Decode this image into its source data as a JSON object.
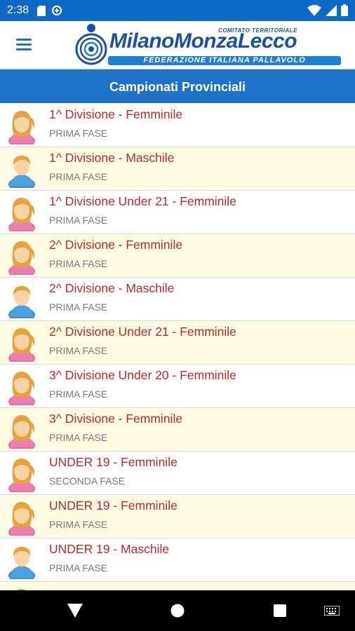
{
  "status_bar": {
    "time": "2:38",
    "icons": [
      "sd-card-icon",
      "data-saver-icon",
      "wifi-icon",
      "signal-icon",
      "battery-icon"
    ]
  },
  "app_bar": {
    "logo": {
      "main_text": "MilanoMonzaLecco",
      "sub_text": "COMITATO TERRITORIALE",
      "band_text": "FEDERAZIONE ITALIANA PALLAVOLO"
    }
  },
  "header": {
    "title": "Campionati Provinciali"
  },
  "championships": [
    {
      "title": "1^ Divisione - Femminile",
      "phase": "PRIMA FASE",
      "gender": "female"
    },
    {
      "title": "1^ Divisione - Maschile",
      "phase": "PRIMA FASE",
      "gender": "male"
    },
    {
      "title": "1^ Divisione Under 21 - Femminile",
      "phase": "PRIMA FASE",
      "gender": "female"
    },
    {
      "title": "2^ Divisione - Femminile",
      "phase": "PRIMA FASE",
      "gender": "female"
    },
    {
      "title": "2^ Divisione - Maschile",
      "phase": "PRIMA FASE",
      "gender": "male"
    },
    {
      "title": "2^ Divisione Under 21 - Femminile",
      "phase": "PRIMA FASE",
      "gender": "female"
    },
    {
      "title": "3^ Divisione Under 20 - Femminile",
      "phase": "PRIMA FASE",
      "gender": "female"
    },
    {
      "title": "3^ Divisione - Femminile",
      "phase": "PRIMA FASE",
      "gender": "female"
    },
    {
      "title": "UNDER 19 - Femminile",
      "phase": "SECONDA FASE",
      "gender": "female"
    },
    {
      "title": "UNDER 19 - Femminile",
      "phase": "PRIMA FASE",
      "gender": "female"
    },
    {
      "title": "UNDER 19 - Maschile",
      "phase": "PRIMA FASE",
      "gender": "male"
    },
    {
      "title": "",
      "phase": "",
      "gender": "female"
    }
  ],
  "colors": {
    "primary": "#1e73c8",
    "status_bar": "#0d69c6",
    "title_red": "#c0282c",
    "alt_row": "#fefce3"
  }
}
